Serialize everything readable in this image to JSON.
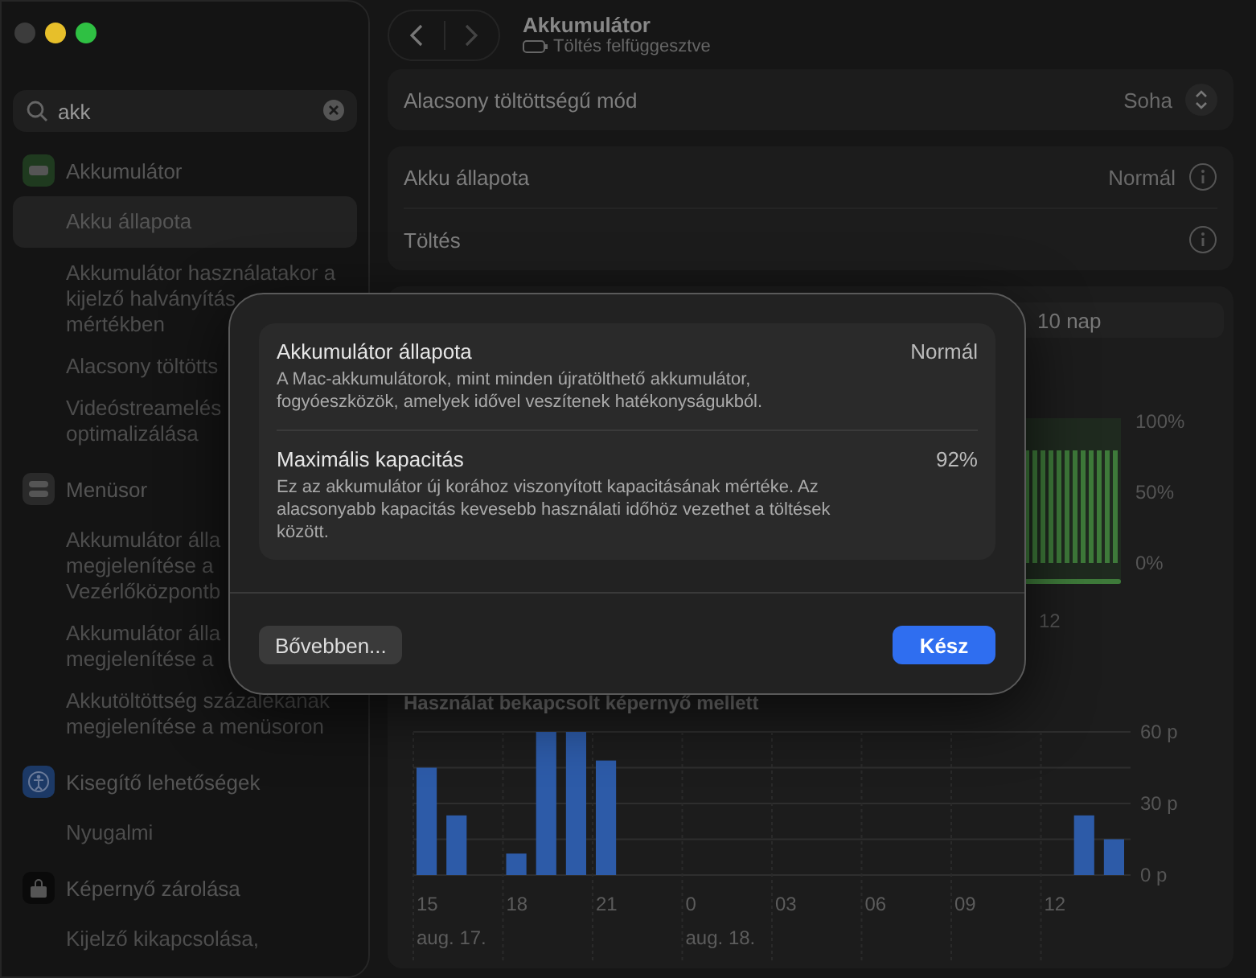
{
  "window": {
    "title": "Akkumulátor",
    "subtitle": "Töltés felfüggesztve"
  },
  "search": {
    "value": "akk"
  },
  "sidebar": {
    "sections": [
      {
        "label": "Akkumulátor",
        "kind": "battery",
        "items": [
          {
            "label": "Akku állapota",
            "selected": true
          },
          {
            "label": "Akkumulátor használatakor a\nkijelző halványítás\nmértékben",
            "selected": false
          },
          {
            "label": "Alacsony töltötts",
            "selected": false
          },
          {
            "label": "Videóstreamelés\noptimalizálása",
            "selected": false
          }
        ]
      },
      {
        "label": "Menüsor",
        "kind": "menubar",
        "items": [
          {
            "label": "Akkumulátor álla\nmegjelenítése a\nVezérlőközpontb",
            "selected": false
          },
          {
            "label": "Akkumulátor álla\nmegjelenítése a",
            "selected": false
          },
          {
            "label": "Akkutöltöttség százalékának\nmegjelenítése a menüsoron",
            "selected": false
          }
        ]
      },
      {
        "label": "Kisegítő lehetőségek",
        "kind": "accessibility",
        "items": [
          {
            "label": "Nyugalmi",
            "selected": false
          }
        ]
      },
      {
        "label": "Képernyő zárolása",
        "kind": "lock",
        "items": [
          {
            "label": "Kijelző kikapcsolása,",
            "selected": false
          }
        ]
      }
    ]
  },
  "low_power": {
    "label": "Alacsony töltöttségű mód",
    "value": "Soha"
  },
  "battery_rows": [
    {
      "label": "Akku állapota",
      "value": "Normál"
    },
    {
      "label": "Töltés"
    }
  ],
  "period_control": {
    "label": "10 nap"
  },
  "level_chart": {
    "y_labels": [
      "100%",
      "50%",
      "0%"
    ],
    "x_labels": [
      "12"
    ]
  },
  "usage_chart": {
    "chart_data": {
      "type": "bar",
      "title": "Használat bekapcsolt képernyő mellett",
      "categories": [
        "15",
        null,
        null,
        "18",
        null,
        null,
        "21",
        null,
        null,
        "0",
        null,
        null,
        "03",
        null,
        null,
        "06",
        null,
        null,
        "09",
        null,
        null,
        "12",
        null,
        null
      ],
      "series": [
        {
          "color": "#2d5ba8",
          "values": [
            45,
            25,
            0,
            9,
            60,
            60,
            48,
            0,
            0,
            0,
            0,
            0,
            0,
            0,
            0,
            0,
            0,
            0,
            0,
            0,
            0,
            0,
            25,
            15
          ]
        }
      ],
      "ylim": [
        0,
        60
      ],
      "yticks": [
        {
          "value": 0,
          "label": "0 p"
        },
        {
          "value": 30,
          "label": "30 p"
        },
        {
          "value": 60,
          "label": "60 p"
        }
      ],
      "annotations": [
        "aug. 17.",
        "aug. 18."
      ]
    }
  },
  "dialog": {
    "rows": [
      {
        "title": "Akkumulátor állapota",
        "value": "Normál",
        "description": "A Mac-akkumulátorok, mint minden újratölthető akkumulátor,\nfogyóeszközök, amelyek idővel veszítenek hatékonyságukból."
      },
      {
        "title": "Maximális kapacitás",
        "value": "92%",
        "description": "Ez az akkumulátor új korához viszonyított kapacitásának mértéke. Az\nalacsonyabb kapacitás kevesebb használati időhöz vezethet a töltések\nközött."
      }
    ],
    "buttons": [
      {
        "label": "Bővebben...",
        "kind": "secondary"
      },
      {
        "label": "Kész",
        "kind": "primary"
      }
    ]
  }
}
